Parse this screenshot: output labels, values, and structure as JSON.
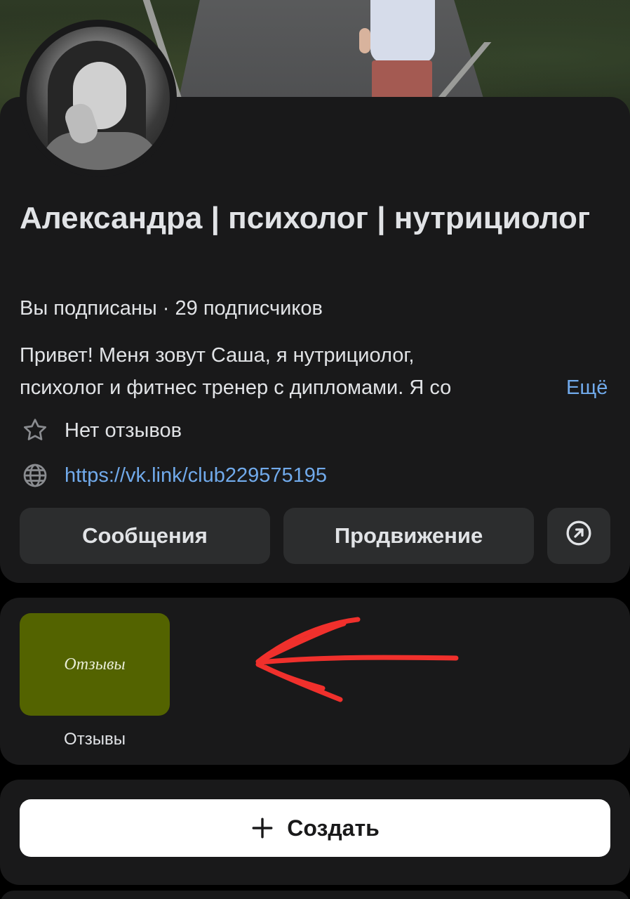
{
  "profile": {
    "title": "Александра | психолог | нутрициолог",
    "subscription": "Вы подписаны · 29 подписчиков",
    "description_line1": "Привет! Меня зовут Саша, я нутрициолог,",
    "description_line2": "психолог и фитнес тренер с дипломами.  Я со",
    "more_label": "Ещё",
    "reviews_text": "Нет отзывов",
    "link_text": "https://vk.link/club229575195"
  },
  "actions": {
    "messages_label": "Сообщения",
    "promo_label": "Продвижение"
  },
  "albums": [
    {
      "cover_text": "Отзывы",
      "caption": "Отзывы"
    }
  ],
  "create": {
    "label": "Создать"
  },
  "annotation": {
    "color": "#f0302c"
  },
  "colors": {
    "background": "#19191a",
    "button": "#2c2d2e",
    "link": "#71aaeb",
    "album_cover": "#536300"
  }
}
